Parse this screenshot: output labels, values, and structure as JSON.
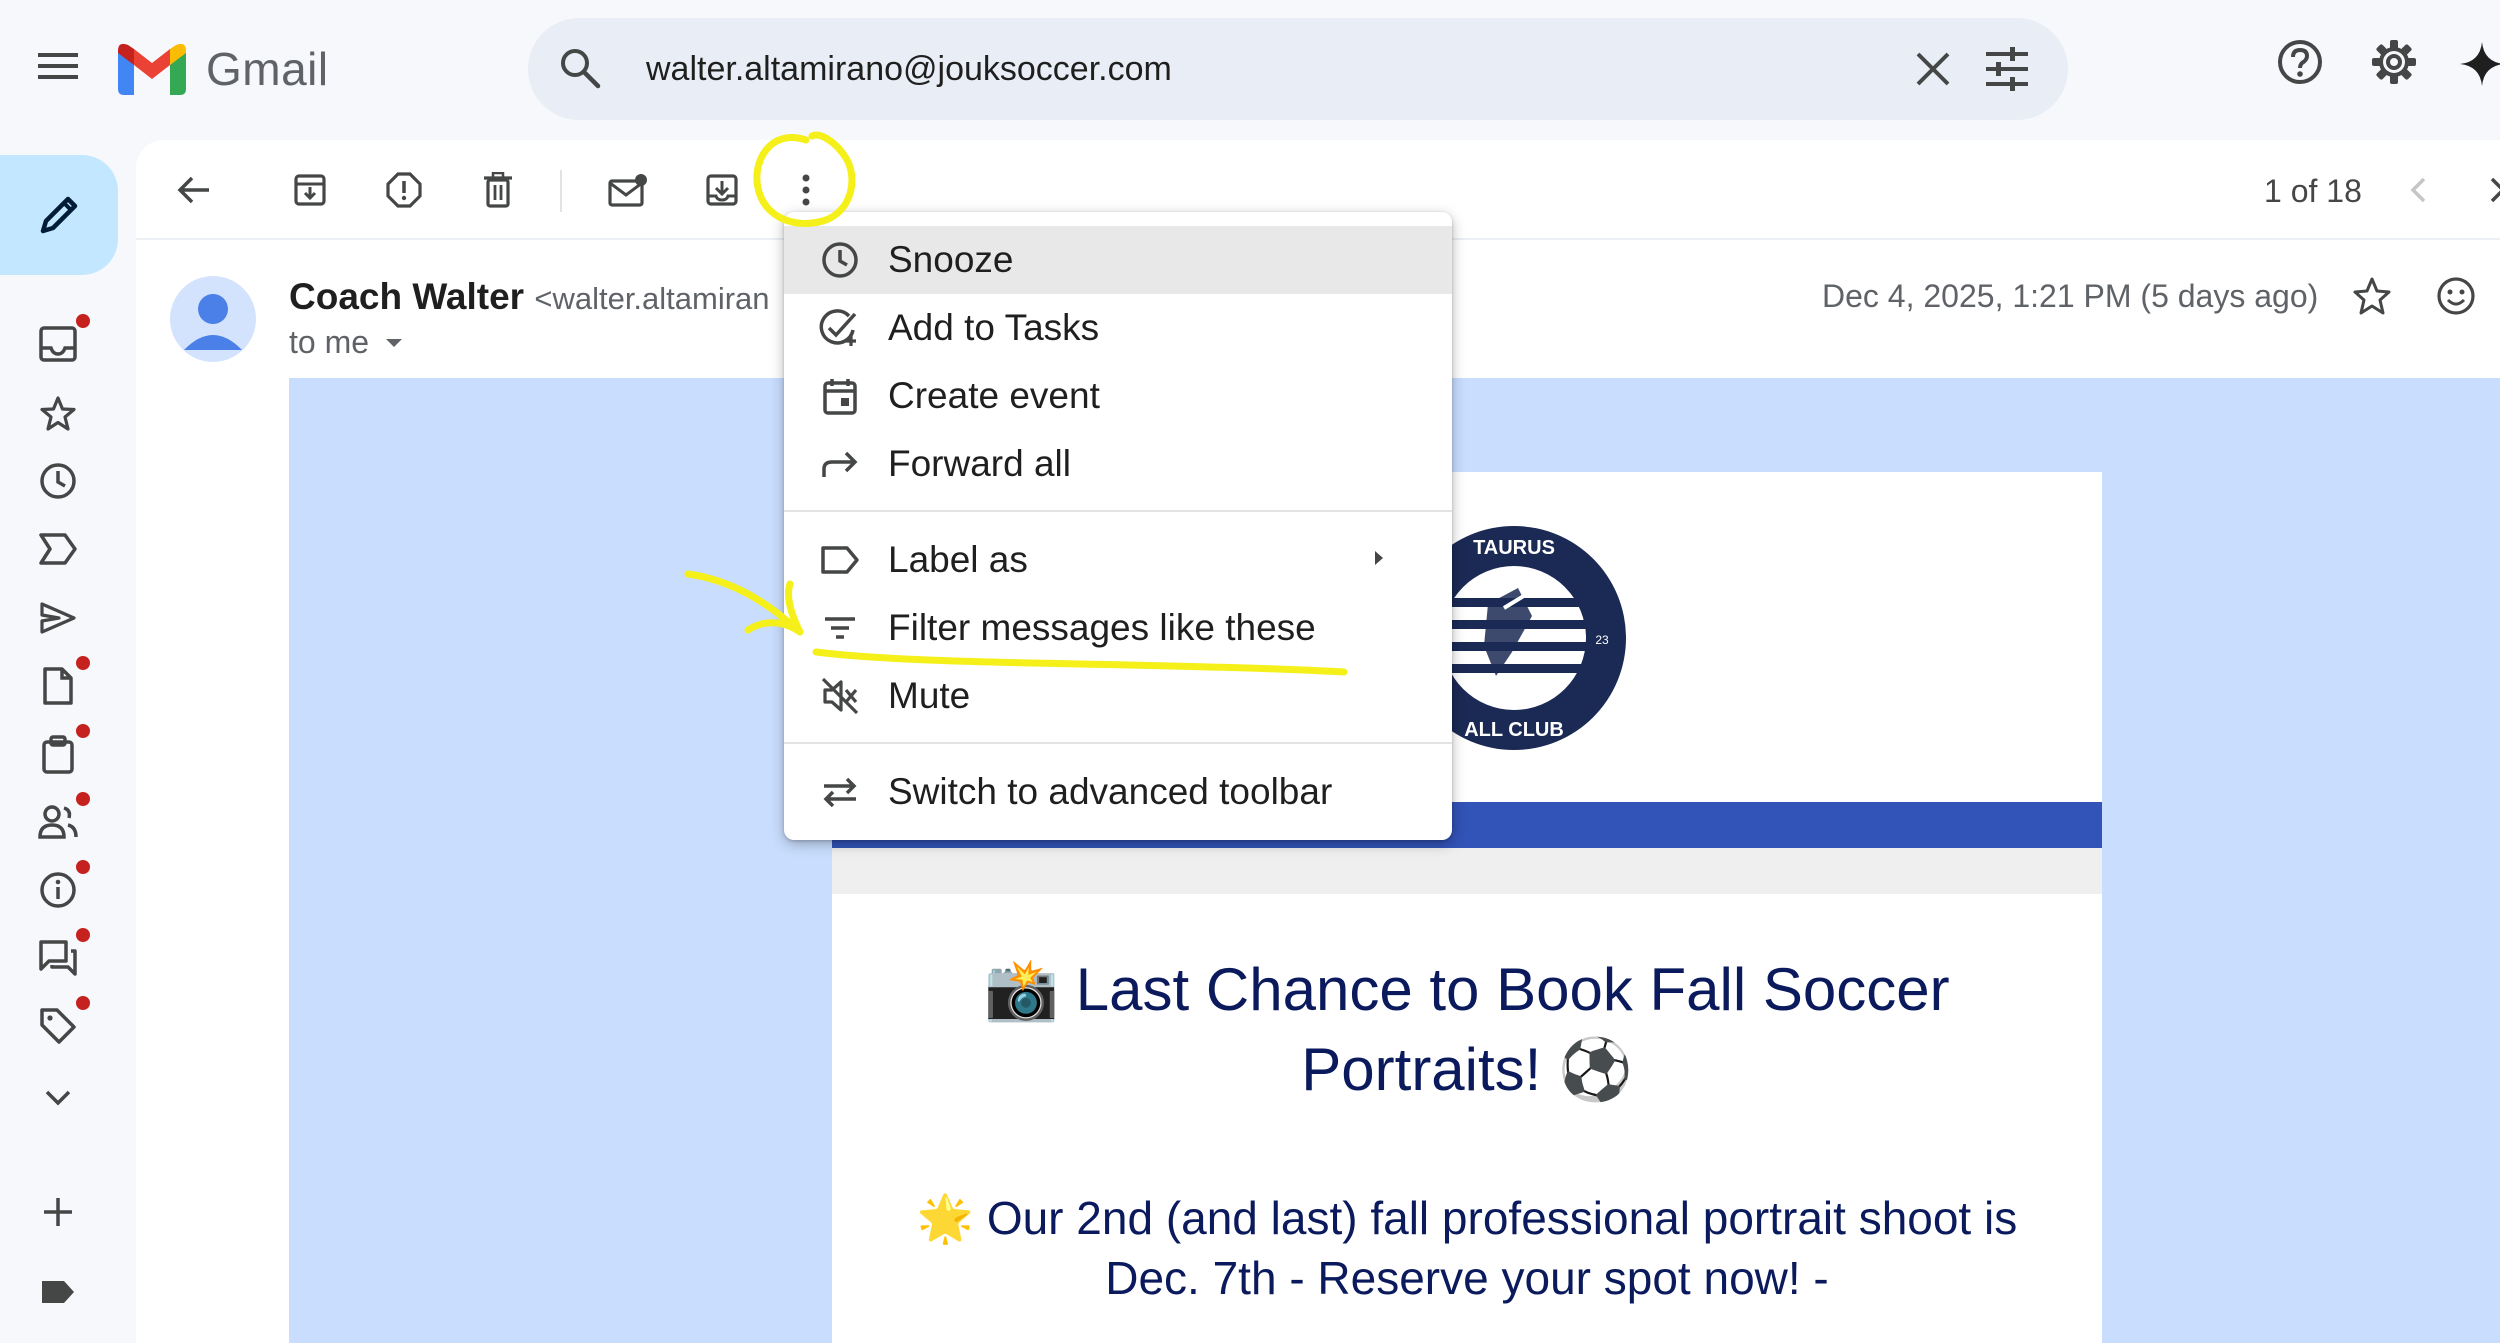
{
  "app": {
    "name": "Gmail"
  },
  "search": {
    "value": "walter.altamirano@jouksoccer.com"
  },
  "toolbar": {
    "pager": "1 of 18"
  },
  "message": {
    "sender_name": "Coach Walter",
    "sender_address": "<walter.altamiran",
    "recipient": "to me",
    "date": "Dec 4, 2025, 1:21 PM (5 days ago)"
  },
  "menu": {
    "items": [
      {
        "label": "Snooze",
        "icon": "clock-icon"
      },
      {
        "label": "Add to Tasks",
        "icon": "add-task-icon"
      },
      {
        "label": "Create event",
        "icon": "calendar-icon"
      },
      {
        "label": "Forward all",
        "icon": "forward-icon"
      },
      {
        "label": "Label as",
        "icon": "label-icon"
      },
      {
        "label": "Filter messages like these",
        "icon": "filter-icon"
      },
      {
        "label": "Mute",
        "icon": "mute-icon"
      },
      {
        "label": "Switch to advanced toolbar",
        "icon": "swap-icon"
      }
    ]
  },
  "email_body": {
    "headline": "📸 Last Chance to Book Fall Soccer Portraits! ⚽",
    "subline": "🌟 Our 2nd (and last) fall professional portrait shoot is Dec. 7th - Reserve your spot now! -",
    "club_logo_text": {
      "top": "TAURUS",
      "bottom": "ALL CLUB",
      "number": "23"
    }
  },
  "colors": {
    "accent": "#c2e7ff",
    "search_bg": "#e9eef6",
    "body_bg": "#c9deff",
    "band": "#3253b7",
    "headline": "#0a1a5c",
    "annotation": "#f5ef1a",
    "notification_dot": "#c5221f"
  }
}
